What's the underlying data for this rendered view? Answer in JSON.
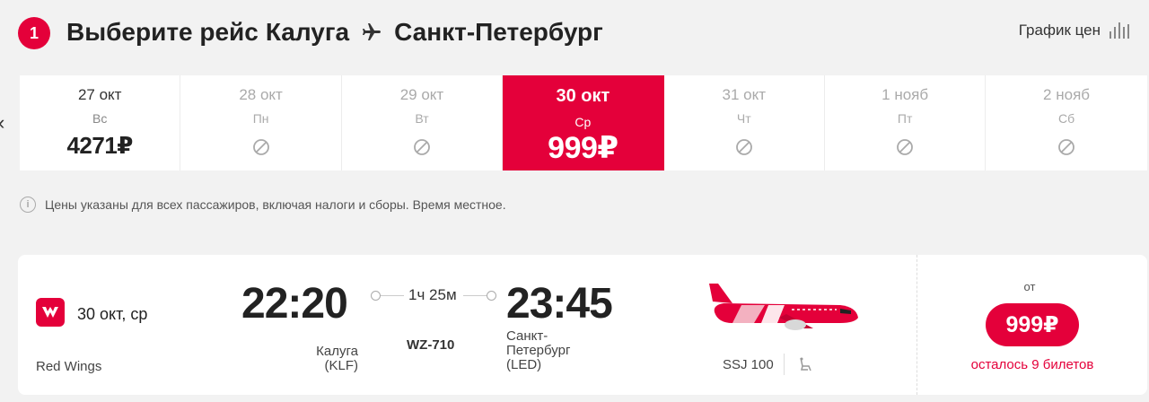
{
  "header": {
    "step": "1",
    "title_prefix": "Выберите рейс",
    "origin": "Калуга",
    "destination": "Санкт-Петербург",
    "price_chart_label": "График цен"
  },
  "dates": [
    {
      "date": "27 окт",
      "weekday": "Вс",
      "price": "4271₽",
      "state": "available"
    },
    {
      "date": "28 окт",
      "weekday": "Пн",
      "price": null,
      "state": "unavailable"
    },
    {
      "date": "29 окт",
      "weekday": "Вт",
      "price": null,
      "state": "unavailable"
    },
    {
      "date": "30 окт",
      "weekday": "Ср",
      "price": "999₽",
      "state": "selected"
    },
    {
      "date": "31 окт",
      "weekday": "Чт",
      "price": null,
      "state": "unavailable"
    },
    {
      "date": "1 нояб",
      "weekday": "Пт",
      "price": null,
      "state": "unavailable"
    },
    {
      "date": "2 нояб",
      "weekday": "Сб",
      "price": null,
      "state": "unavailable"
    }
  ],
  "notice": "Цены указаны для всех пассажиров, включая налоги и сборы. Время местное.",
  "flight": {
    "date": "30 окт, ср",
    "airline": "Red Wings",
    "departure_time": "22:20",
    "arrival_time": "23:45",
    "duration": "1ч 25м",
    "flight_number": "WZ-710",
    "departure_city": "Калуга",
    "departure_code": "(KLF)",
    "arrival_city_line1": "Санкт-",
    "arrival_city_line2": "Петербург",
    "arrival_code": "(LED)",
    "aircraft": "SSJ 100",
    "from_label": "от",
    "price": "999₽",
    "seats_left": "осталось 9 билетов"
  },
  "colors": {
    "accent": "#e4003a",
    "background": "#f2f2f2"
  }
}
